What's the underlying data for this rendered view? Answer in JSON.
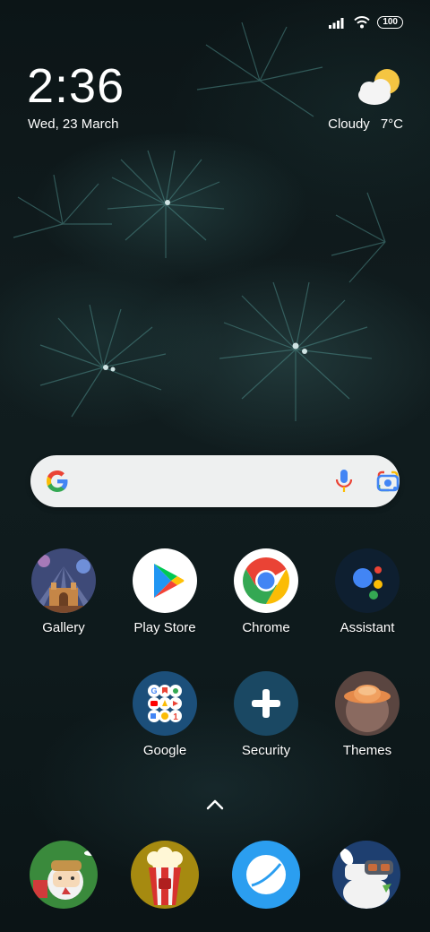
{
  "status_bar": {
    "battery": "100",
    "icons": [
      "signal-icon",
      "wifi-icon",
      "battery-icon"
    ]
  },
  "clock": {
    "time": "2:36",
    "date": "Wed, 23 March"
  },
  "weather": {
    "condition": "Cloudy",
    "temperature": "7°C",
    "icon": "partly-cloudy-icon"
  },
  "search_bar": {
    "icons": [
      "google-g-icon",
      "microphone-icon",
      "google-lens-icon"
    ]
  },
  "apps_row1": [
    {
      "label": "Gallery"
    },
    {
      "label": "Play Store"
    },
    {
      "label": "Chrome"
    },
    {
      "label": "Assistant"
    }
  ],
  "apps_row2": [
    {
      "label": "Google"
    },
    {
      "label": "Security"
    },
    {
      "label": "Themes"
    }
  ],
  "dock": [
    "mi-community-icon",
    "mi-video-icon",
    "mi-browser-icon",
    "mi-explorer-icon"
  ],
  "colors": {
    "wallpaper_dark": "#0e1a1c",
    "search_bg": "#eef0f0",
    "chrome_blue": "#4285f4"
  }
}
